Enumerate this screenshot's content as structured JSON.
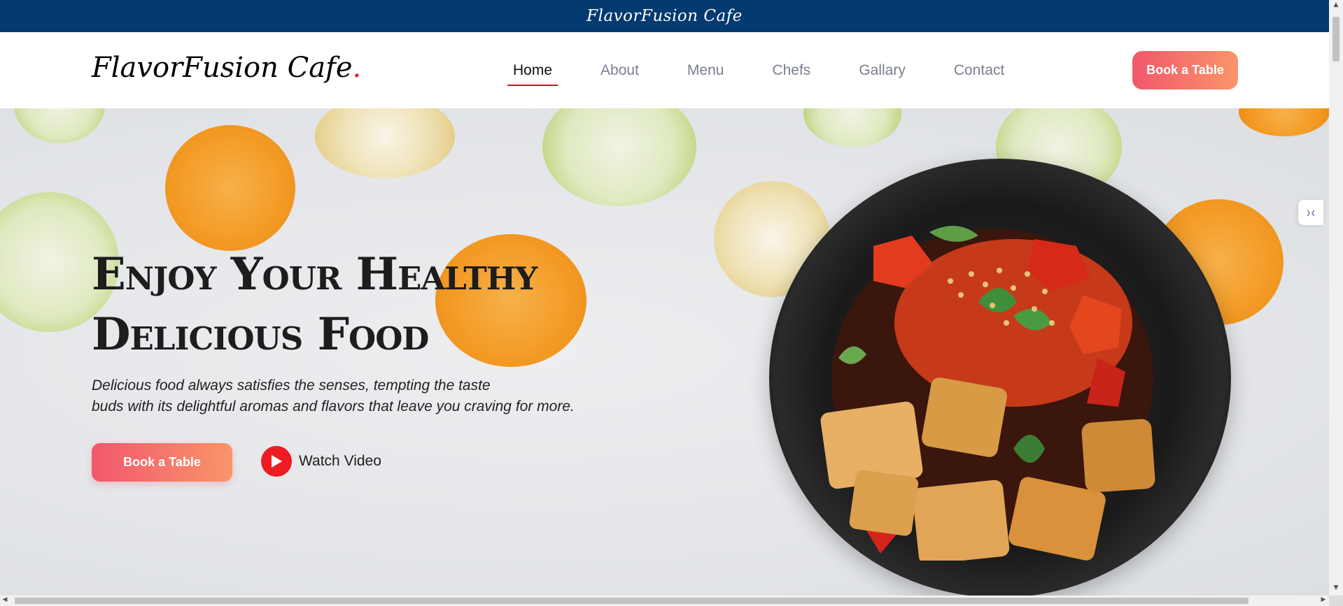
{
  "topbar": {
    "title": "FlavorFusion Cafe"
  },
  "header": {
    "logo_text": "FlavorFusion Cafe",
    "logo_dot": ".",
    "nav": [
      {
        "label": "Home",
        "active": true
      },
      {
        "label": "About",
        "active": false
      },
      {
        "label": "Menu",
        "active": false
      },
      {
        "label": "Chefs",
        "active": false
      },
      {
        "label": "Gallary",
        "active": false
      },
      {
        "label": "Contact",
        "active": false
      }
    ],
    "cta_label": "Book a Table"
  },
  "hero": {
    "title_line1": "Enjoy Your Healthy",
    "title_line2": "Delicious Food",
    "desc_line1": "Delicious food always satisfies the senses, tempting the taste",
    "desc_line2": "buds with its delightful aromas and flavors that leave you craving for more.",
    "cta_label": "Book a Table",
    "watch_label": "Watch Video"
  },
  "side_widget": {
    "icon": "translate-widget-icon"
  },
  "colors": {
    "topbar_bg": "#033a6f",
    "accent_red": "#e11d2a",
    "cta_gradient_start": "#f2576c",
    "cta_gradient_end": "#f9956a",
    "play_red": "#ed1c24"
  }
}
